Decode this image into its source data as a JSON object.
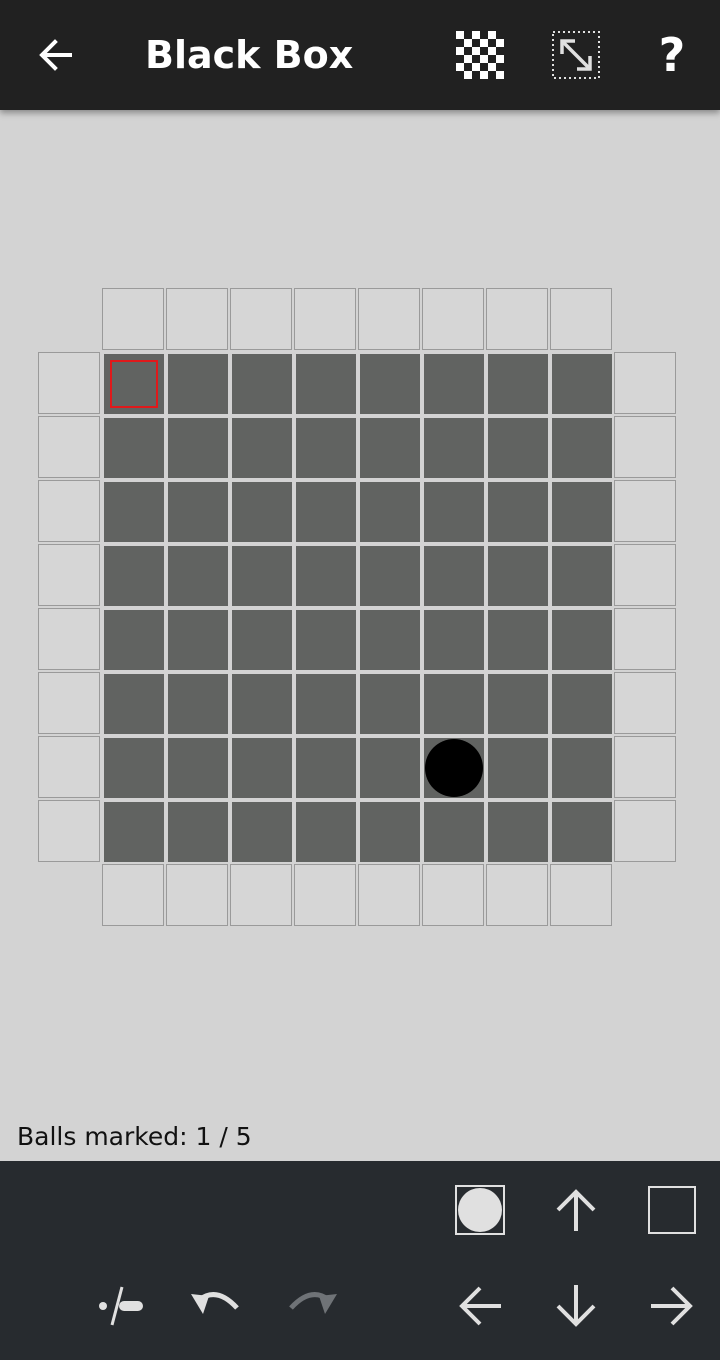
{
  "app": {
    "title": "Black Box"
  },
  "toolbar": {
    "back_icon": "arrow-left-icon",
    "checker_icon": "checkerboard-icon",
    "resize_icon": "resize-icon",
    "help_label": "?"
  },
  "board": {
    "size": 8,
    "ball_marks": [
      {
        "row": 6,
        "col": 5
      }
    ],
    "cursor": {
      "row": 0,
      "col": 0
    },
    "colors": {
      "interior": "#616361",
      "edge": "#d6d6d6",
      "cursor": "#e0191b",
      "ball": "#000000"
    }
  },
  "status": {
    "text": "Balls marked: 1 / 5"
  },
  "controls": {
    "ball_toggle_icon": "ball-toggle-icon",
    "up_icon": "arrow-up-icon",
    "clear_icon": "empty-square-icon",
    "mark_icon": "mark-toggle-icon",
    "undo_icon": "undo-icon",
    "redo_icon": "redo-icon",
    "left_icon": "arrow-left-icon",
    "down_icon": "arrow-down-icon",
    "right_icon": "arrow-right-icon"
  }
}
